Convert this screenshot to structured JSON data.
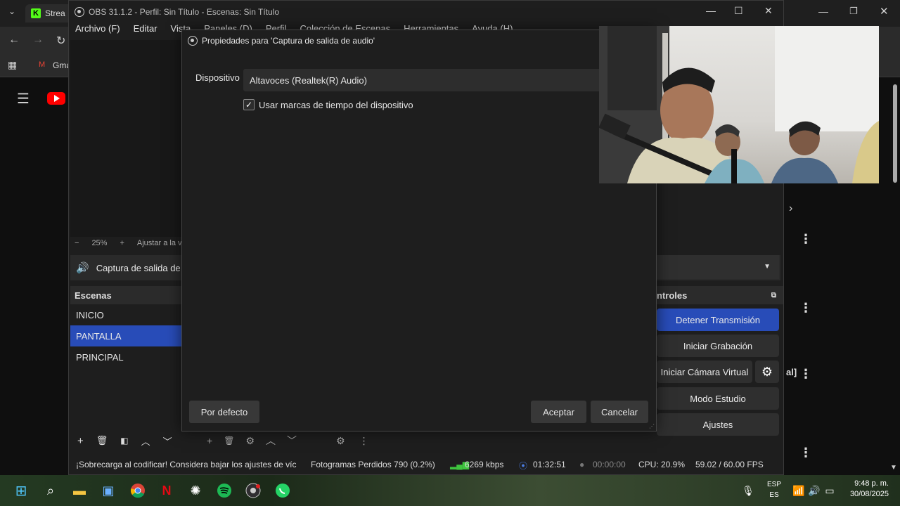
{
  "browser": {
    "tab_title": "Strea",
    "bookmark_gmail": "Gma"
  },
  "obs": {
    "title": "OBS 31.1.2 - Perfil: Sin Título - Escenas: Sin Título",
    "menu": [
      "Archivo (F)",
      "Editar",
      "Vista",
      "Paneles (D)",
      "Perfil",
      "Colección de Escenas",
      "Herramientas",
      "Ayuda (H)"
    ],
    "zoom": {
      "minus": "−",
      "value": "25%",
      "plus": "+",
      "fit": "Ajustar a la ve"
    },
    "source_name": "Captura de salida de au",
    "scenes": {
      "title": "Escenas",
      "items": [
        "INICIO",
        "PANTALLA",
        "PRINCIPAL"
      ],
      "selected": "PANTALLA"
    },
    "controls": {
      "title": "ntroles",
      "stop_stream": "Detener Transmisión",
      "start_recording": "Iniciar Grabación",
      "virtual_cam": "Iniciar Cámara Virtual",
      "studio_mode": "Modo Estudio",
      "settings": "Ajustes"
    },
    "status": {
      "warning": "¡Sobrecarga al codificar! Considera bajar los ajustes de víc",
      "dropped": "Fotogramas Perdidos 790 (0.2%)",
      "bitrate": "6269 kbps",
      "stream_time": "01:32:51",
      "rec_time": "00:00:00",
      "cpu": "CPU: 20.9%",
      "fps": "59.02 / 60.00 FPS"
    }
  },
  "dialog": {
    "title": "Propiedades para 'Captura de salida de audio'",
    "device_label": "Dispositivo",
    "device_value": "Altavoces (Realtek(R) Audio)",
    "timestamps_label": "Usar marcas de tiempo del dispositivo",
    "timestamps_checked": true,
    "defaults_button": "Por defecto",
    "accept_button": "Aceptar",
    "cancel_button": "Cancelar"
  },
  "taskbar": {
    "lang_top": "ESP",
    "lang_bottom": "ES",
    "time": "9:48 p. m.",
    "date": "30/08/2025"
  },
  "colors": {
    "accent": "#284cb8",
    "kick": "#53fc18",
    "youtube": "#ff0000"
  }
}
